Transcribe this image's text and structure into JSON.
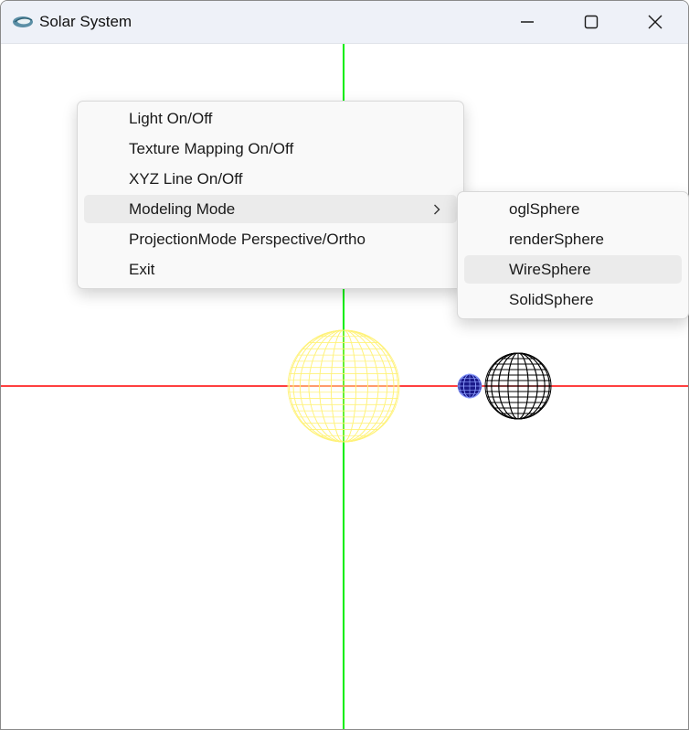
{
  "window": {
    "title": "Solar System",
    "app_icon": "opengl-app-icon",
    "controls": [
      "minimize-icon",
      "maximize-icon",
      "close-icon"
    ]
  },
  "scene": {
    "axis_colors": {
      "x": "#ff0000",
      "y": "#00ee00"
    },
    "sun_color": "#fff27a",
    "earth_color": "#000000",
    "moon_color": "#1a1a8a"
  },
  "context_menu": {
    "items": [
      {
        "label": "Light On/Off"
      },
      {
        "label": "Texture Mapping On/Off"
      },
      {
        "label": "XYZ Line On/Off"
      },
      {
        "label": "Modeling Mode",
        "has_submenu": true,
        "highlighted": true
      },
      {
        "label": "ProjectionMode Perspective/Ortho"
      },
      {
        "label": "Exit"
      }
    ]
  },
  "submenu": {
    "items": [
      {
        "label": "oglSphere"
      },
      {
        "label": "renderSphere"
      },
      {
        "label": "WireSphere",
        "highlighted": true
      },
      {
        "label": "SolidSphere"
      }
    ]
  }
}
